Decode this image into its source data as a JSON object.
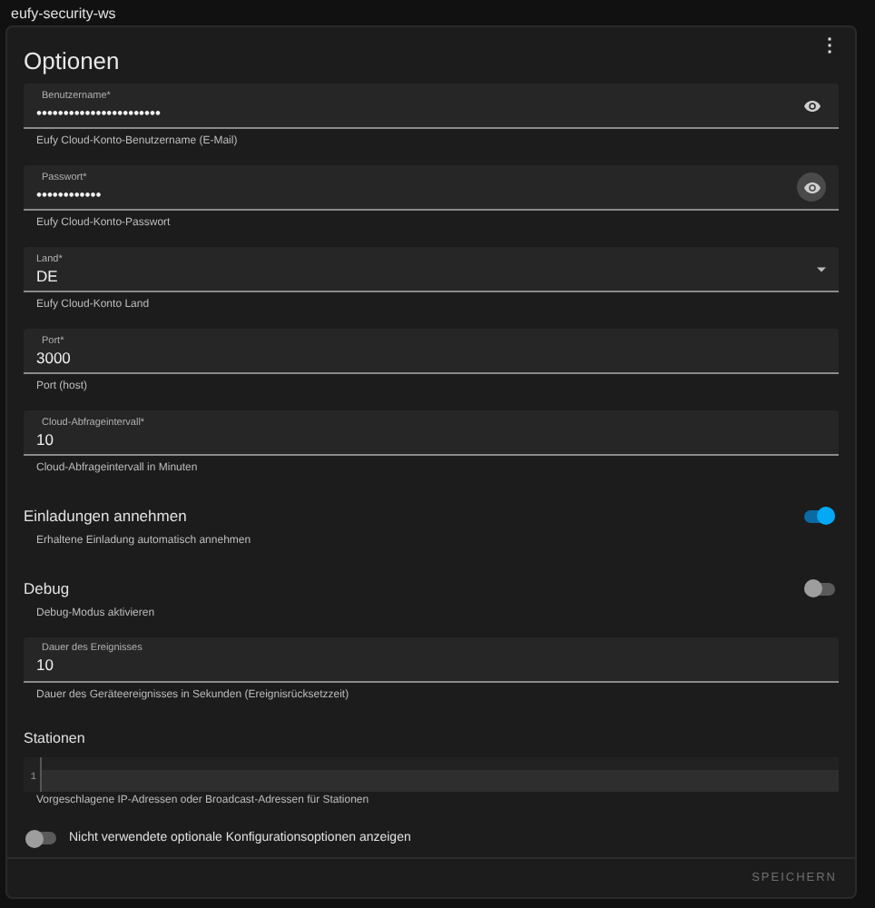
{
  "window": {
    "title": "eufy-security-ws"
  },
  "card": {
    "title": "Optionen",
    "menu": "⋮"
  },
  "options": [
    {
      "kind": "secret",
      "label": "Benutzername*",
      "value": "•••••••••••••••••••••••",
      "helper": "Eufy Cloud-Konto-Benutzername (E-Mail)",
      "button_highlighted": false
    },
    {
      "kind": "secret",
      "label": "Passwort*",
      "value": "••••••••••••",
      "helper": "Eufy Cloud-Konto-Passwort",
      "button_highlighted": true
    },
    {
      "kind": "select",
      "label": "Land*",
      "value": "DE",
      "helper": "Eufy Cloud-Konto Land"
    },
    {
      "kind": "text",
      "label": "Port*",
      "value": "3000",
      "helper": "Port (host)"
    },
    {
      "kind": "text",
      "label": "Cloud-Abfrageintervall*",
      "value": "10",
      "helper": "Cloud-Abfrageintervall in Minuten"
    },
    {
      "kind": "toggle",
      "label": "Einladungen annehmen",
      "on": true,
      "helper": "Erhaltene Einladung automatisch annehmen"
    },
    {
      "kind": "toggle",
      "label": "Debug",
      "on": false,
      "helper": "Debug-Modus aktivieren"
    },
    {
      "kind": "text",
      "label": "Dauer des Ereignisses",
      "value": "10",
      "helper": "Dauer des Geräteereignisses in Sekunden (Ereignisrücksetzzeit)"
    },
    {
      "kind": "code",
      "label": "Stationen",
      "line_number": "1",
      "helper": "Vorgeschlagene IP-Adressen oder Broadcast-Adressen für Stationen"
    }
  ],
  "show_unused": {
    "label": "Nicht verwendete optionale Konfigurationsoptionen anzeigen",
    "on": false
  },
  "save_button": "SPEICHERN"
}
